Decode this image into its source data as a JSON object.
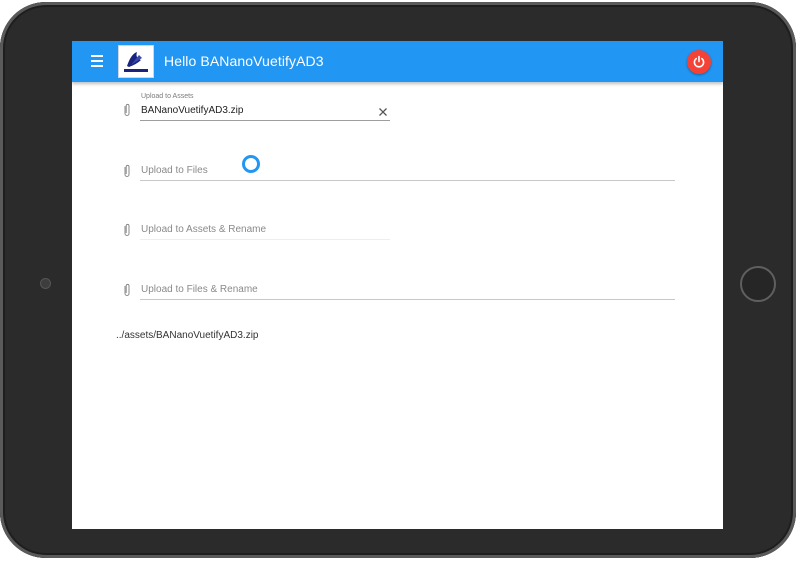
{
  "app": {
    "title": "Hello BANanoVuetifyAD3",
    "logo_text": "BANanoVuetify",
    "colors": {
      "primary": "#2196f3",
      "danger": "#f44336"
    }
  },
  "toolbar": {
    "menu_icon": "menu-icon",
    "power_icon": "power-icon"
  },
  "fields": [
    {
      "label": "Upload to Assets",
      "value": "BANanoVuetifyAD3.zip",
      "icon": "paperclip-icon",
      "clear_icon": "close-icon"
    },
    {
      "placeholder": "Upload to Files",
      "icon": "paperclip-icon"
    },
    {
      "placeholder": "Upload to Assets & Rename",
      "icon": "paperclip-icon"
    },
    {
      "placeholder": "Upload to Files & Rename",
      "icon": "paperclip-icon"
    }
  ],
  "output": {
    "path": "../assets/BANanoVuetifyAD3.zip"
  }
}
